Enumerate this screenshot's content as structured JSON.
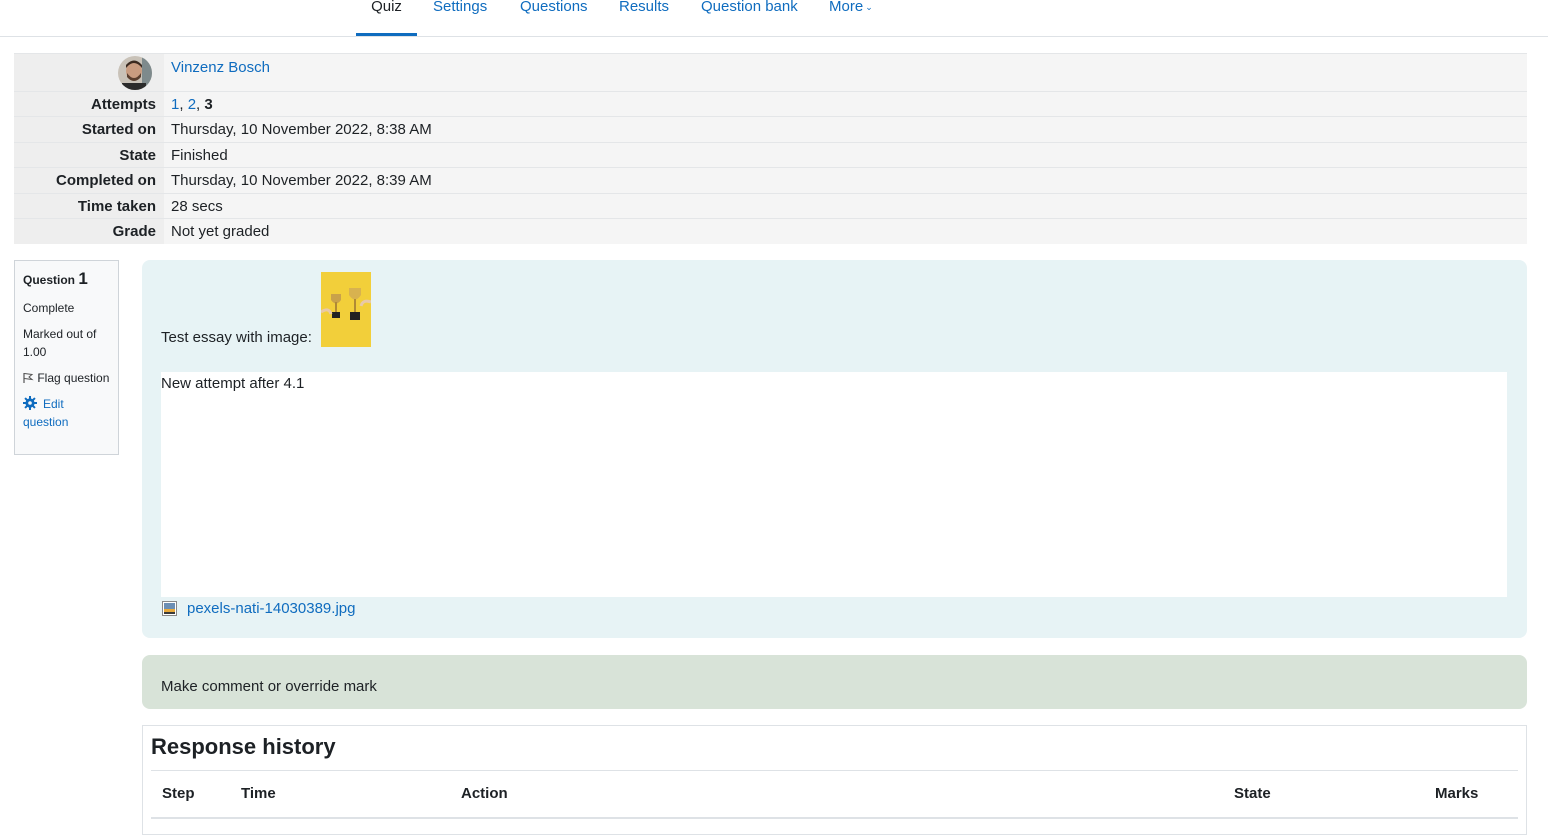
{
  "nav": {
    "tabs": [
      {
        "label": "Quiz",
        "active": true
      },
      {
        "label": "Settings"
      },
      {
        "label": "Questions"
      },
      {
        "label": "Results"
      },
      {
        "label": "Question bank"
      },
      {
        "label": "More"
      }
    ]
  },
  "summary": {
    "user_name": "Vinzenz Bosch",
    "attempts_label": "Attempts",
    "attempts": [
      "1",
      "2",
      "3"
    ],
    "rows": [
      {
        "label": "Started on",
        "value": "Thursday, 10 November 2022, 8:38 AM"
      },
      {
        "label": "State",
        "value": "Finished"
      },
      {
        "label": "Completed on",
        "value": "Thursday, 10 November 2022, 8:39 AM"
      },
      {
        "label": "Time taken",
        "value": "28 secs"
      },
      {
        "label": "Grade",
        "value": "Not yet graded"
      }
    ]
  },
  "question": {
    "label": "Question",
    "number": "1",
    "status": "Complete",
    "marked_out_of": "Marked out of 1.00",
    "flag_label": "Flag question",
    "edit_label": "Edit question",
    "prompt": "Test essay with image:",
    "answer_text": "New attempt after 4.1",
    "attachment_name": "pexels-nati-14030389.jpg"
  },
  "comment": {
    "link": "Make comment or override mark"
  },
  "history": {
    "title": "Response history",
    "columns": [
      "Step",
      "Time",
      "Action",
      "State",
      "Marks"
    ]
  },
  "colors": {
    "link": "#0f6cbf",
    "question_bg": "#e7f3f5",
    "comment_bg": "#d8e3d8",
    "label_bg": "#eeeeee"
  }
}
